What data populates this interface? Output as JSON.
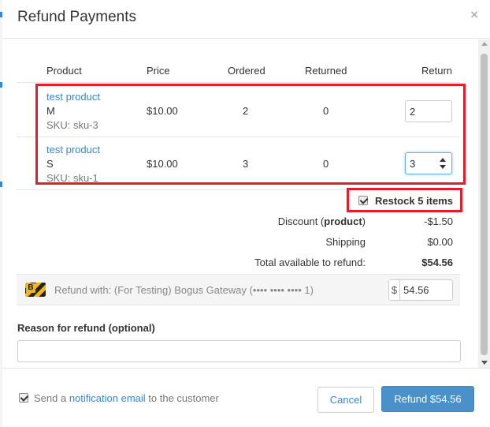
{
  "modal": {
    "title": "Refund Payments",
    "close_glyph": "×"
  },
  "table": {
    "headers": {
      "product": "Product",
      "price": "Price",
      "ordered": "Ordered",
      "returned": "Returned",
      "return": "Return"
    },
    "rows": [
      {
        "name": "test product",
        "variant": "M",
        "sku": "SKU: sku-3",
        "price": "$10.00",
        "ordered": "2",
        "returned": "0",
        "return_value": "2"
      },
      {
        "name": "test product",
        "variant": "S",
        "sku": "SKU: sku-1",
        "price": "$10.00",
        "ordered": "3",
        "returned": "0",
        "return_value": "3"
      }
    ]
  },
  "restock": {
    "label": "Restock 5 items",
    "checked": true
  },
  "summary": {
    "discount_prefix": "Discount (",
    "discount_bold": "product",
    "discount_suffix": ")",
    "discount_value": "-$1.50",
    "shipping_label": "Shipping",
    "shipping_value": "$0.00",
    "total_label": "Total available to refund:",
    "total_value": "$54.56"
  },
  "gateway": {
    "icon": "bogus-gateway-icon",
    "icon_letter": "B",
    "text": "Refund with: (For Testing) Bogus Gateway (•••• •••• •••• 1)",
    "currency_symbol": "$",
    "amount": "54.56"
  },
  "reason": {
    "label": "Reason for refund (optional)",
    "value": ""
  },
  "footer": {
    "notify_prefix": "Send a ",
    "notify_link": "notification email",
    "notify_suffix": " to the customer",
    "notify_checked": true,
    "cancel_label": "Cancel",
    "refund_label": "Refund $54.56"
  },
  "colors": {
    "link": "#3a87c8",
    "primary_button": "#4a90c9",
    "highlight_box": "#e01e2e"
  }
}
